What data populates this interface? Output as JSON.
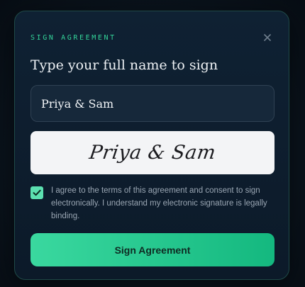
{
  "modal": {
    "eyebrow": "SIGN AGREEMENT",
    "title": "Type your full name to sign",
    "close_icon": "close-icon"
  },
  "name_field": {
    "value": "Priya & Sam"
  },
  "signature_preview": {
    "text": "Priya & Sam"
  },
  "consent": {
    "checked": true,
    "checkbox_icon": "checkmark-icon",
    "text": "I agree to the terms of this agreement and consent to sign electronically. I understand my electronic signature is legally binding."
  },
  "submit": {
    "label": "Sign Agreement"
  },
  "colors": {
    "accent": "#34d399",
    "checkbox": "#5ce0b0",
    "button_start": "#3ad89f",
    "button_end": "#14b87f",
    "modal_border": "#1f4a48"
  }
}
